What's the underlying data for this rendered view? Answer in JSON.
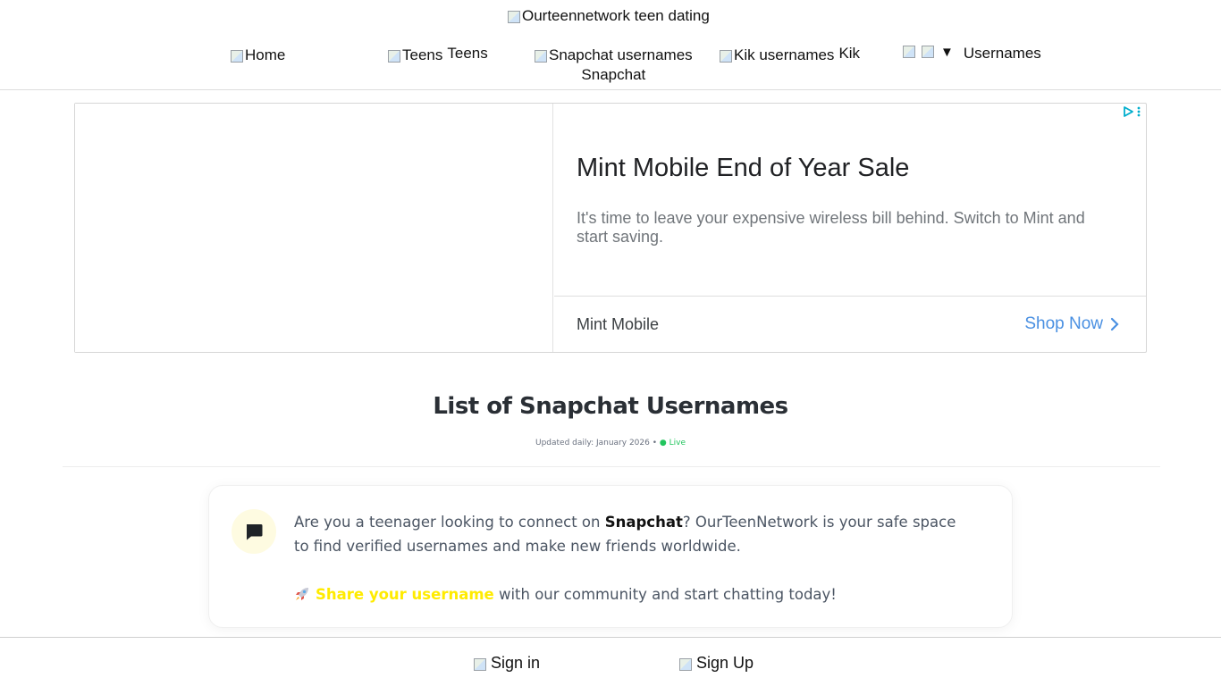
{
  "header": {
    "logo_alt": "Ourteennetwork teen dating",
    "nav": {
      "home": {
        "alt": "Home",
        "label": ""
      },
      "teens": {
        "alt": "Teens",
        "label": "Teens"
      },
      "snapchat": {
        "alt": "Snapchat usernames",
        "label": "Snapchat"
      },
      "kik": {
        "alt": "Kik usernames",
        "label": "Kik"
      },
      "usernames": {
        "arrow": "▼",
        "label": "Usernames"
      }
    }
  },
  "ad": {
    "title": "Mint Mobile End of Year Sale",
    "description": "It's time to leave your expensive wireless bill behind. Switch to Mint and start saving.",
    "advertiser": "Mint Mobile",
    "cta": "Shop Now",
    "accent_color": "#4a90e2",
    "choices_color": "#00aecd"
  },
  "main": {
    "title": "List of Snapchat Usernames",
    "updated": "Updated daily: January 2026 •",
    "live": "● Live"
  },
  "intro": {
    "text_before": "Are you a teenager looking to connect on ",
    "text_bold": "Snapchat",
    "text_after": "? OurTeenNetwork is your safe space to find verified usernames and make new friends worldwide.",
    "share_link": "Share your username",
    "share_rest": " with our community and start chatting today!",
    "share_color": "#ffeb00",
    "icon": "chat-bubble-icon",
    "rocket_icon": "rocket-icon"
  },
  "footer_bar": {
    "signin": "Sign in",
    "signup": "Sign Up"
  }
}
